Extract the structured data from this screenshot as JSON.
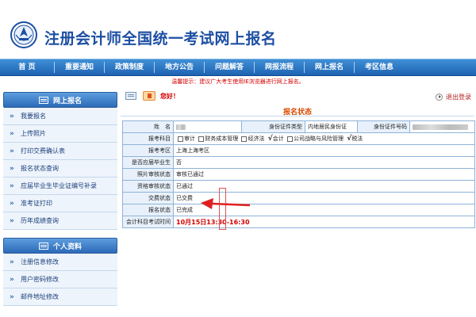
{
  "header": {
    "title": "注册会计师全国统一考试网上报名"
  },
  "nav": {
    "items": [
      "首 页",
      "重要通知",
      "政策制度",
      "地方公告",
      "问题解答",
      "网报流程",
      "网上报名",
      "考区信息"
    ]
  },
  "notice": "温馨提示：建议广大考生使用IE浏览器进行网上报名。",
  "sidebar": {
    "section1": {
      "title": "网上报名",
      "items": [
        "我要报名",
        "上传照片",
        "打印交费确认表",
        "报名状态查询",
        "应届毕业生毕业证编号补录",
        "准考证打印",
        "历年成绩查询"
      ]
    },
    "section2": {
      "title": "个人资料",
      "items": [
        "注册信息修改",
        "用户密码修改",
        "邮件地址修改"
      ]
    }
  },
  "main": {
    "greeting": "您好！",
    "logout": "退出登录",
    "panel_title": "报名状态",
    "rows": {
      "name_label": "姓　名",
      "id_type_label": "身份证件类型",
      "id_type_value": "内地居民身份证",
      "id_no_label": "身份证件号码",
      "subjects_label": "报考科目",
      "subjects": [
        {
          "name": "审计",
          "checked": false
        },
        {
          "name": "财务成本管理",
          "checked": false
        },
        {
          "name": "经济法",
          "checked": false
        },
        {
          "name": "会计",
          "checked": true
        },
        {
          "name": "公司战略与风险管理",
          "checked": false
        },
        {
          "name": "税法",
          "checked": true
        }
      ],
      "region_label": "报考考区",
      "region_value": "上海上海考区",
      "graduate_label": "是否应届毕业生",
      "graduate_value": "否",
      "photo_label": "照片审核状态",
      "photo_value": "审核已通过",
      "qual_label": "资格审核状态",
      "qual_value": "已通过",
      "pay_label": "交费状态",
      "pay_value": "已交费",
      "reg_label": "报名状态",
      "reg_value": "已完成",
      "exam_label": "会计科目考试时间",
      "exam_value": "10月15日13:30-16:30"
    }
  },
  "colors": {
    "nav": "#1e63b2",
    "title": "#1d4fa3",
    "accent_red": "#d40000",
    "annotation_red": "#e02020"
  }
}
